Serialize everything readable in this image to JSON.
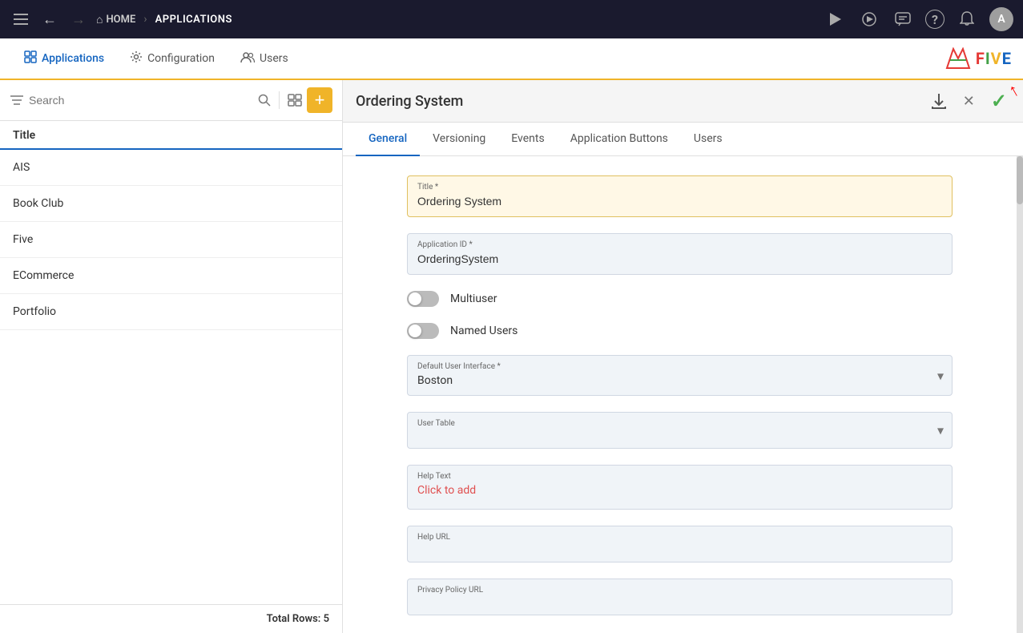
{
  "topNav": {
    "home_label": "HOME",
    "apps_label": "APPLICATIONS",
    "home_icon": "⌂",
    "menu_icon": "☰",
    "back_icon": "←",
    "fwd_icon": "→",
    "sep": "›"
  },
  "topNavRight": {
    "play_icon": "▶",
    "preview_icon": "▷",
    "chat_icon": "💬",
    "help_icon": "?",
    "bell_icon": "🔔",
    "avatar_label": "A"
  },
  "secondaryNav": {
    "tabs": [
      {
        "id": "applications",
        "label": "Applications",
        "icon": "◻"
      },
      {
        "id": "configuration",
        "label": "Configuration",
        "icon": "⚙"
      },
      {
        "id": "users",
        "label": "Users",
        "icon": "👥"
      }
    ]
  },
  "sidebar": {
    "search_placeholder": "Search",
    "header": "Title",
    "items": [
      {
        "id": "ais",
        "label": "AIS"
      },
      {
        "id": "bookclub",
        "label": "Book Club"
      },
      {
        "id": "five",
        "label": "Five"
      },
      {
        "id": "ecommerce",
        "label": "ECommerce"
      },
      {
        "id": "portfolio",
        "label": "Portfolio"
      }
    ],
    "active_item": "ordering-system",
    "footer": "Total Rows: 5",
    "total_rows_label": "Total Rows: 5"
  },
  "contentHeader": {
    "title": "Ordering System",
    "download_icon": "⬇",
    "close_icon": "✕",
    "save_icon": "✓"
  },
  "tabs": {
    "items": [
      {
        "id": "general",
        "label": "General"
      },
      {
        "id": "versioning",
        "label": "Versioning"
      },
      {
        "id": "events",
        "label": "Events"
      },
      {
        "id": "appbuttons",
        "label": "Application Buttons"
      },
      {
        "id": "users",
        "label": "Users"
      }
    ],
    "active": "general"
  },
  "form": {
    "title_label": "Title *",
    "title_value": "Ordering System",
    "appid_label": "Application ID *",
    "appid_value": "OrderingSystem",
    "multiuser_label": "Multiuser",
    "named_users_label": "Named Users",
    "default_ui_label": "Default User Interface *",
    "default_ui_value": "Boston",
    "user_table_label": "User Table",
    "user_table_value": "",
    "help_text_label": "Help Text",
    "help_text_value": "Click to add",
    "help_url_label": "Help URL",
    "help_url_value": "",
    "privacy_policy_label": "Privacy Policy URL",
    "privacy_policy_value": ""
  },
  "fiveLogo": {
    "letters": [
      "F",
      "I",
      "V",
      "E"
    ],
    "prefix": "≡≡≡"
  }
}
